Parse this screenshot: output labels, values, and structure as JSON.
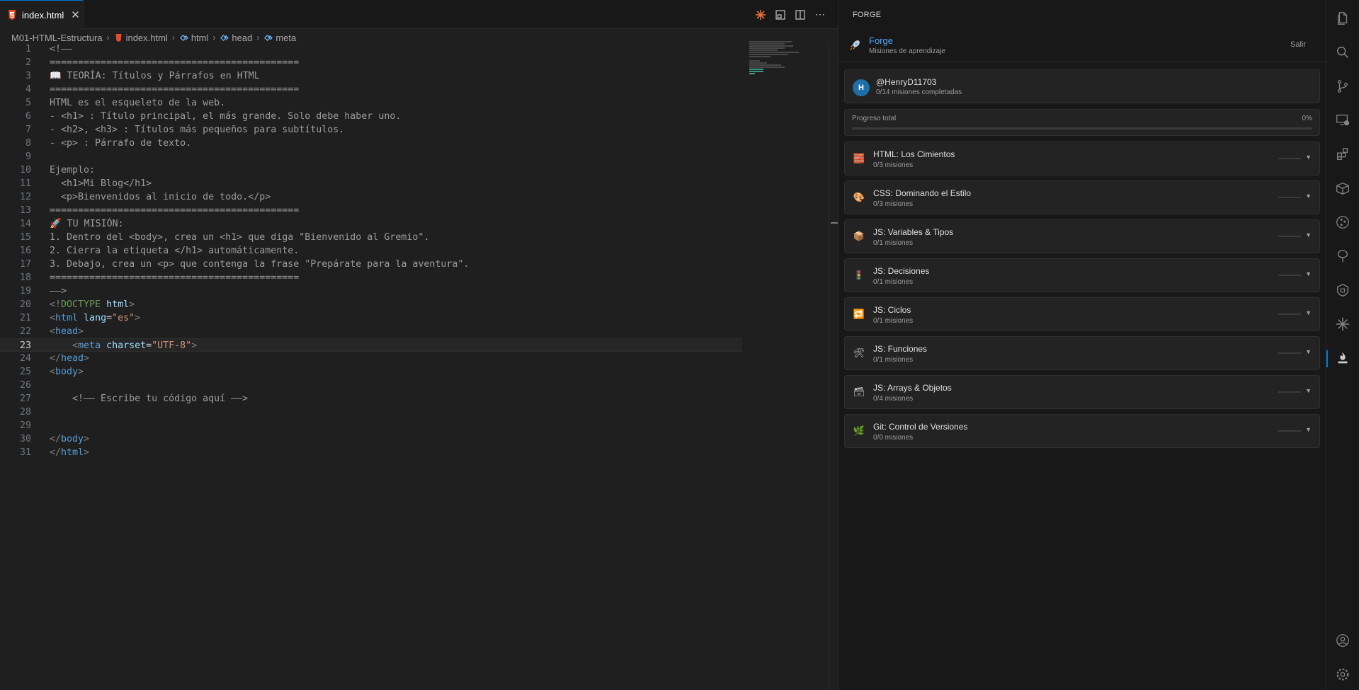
{
  "editor": {
    "tab_label": "index.html",
    "tab_close": "✕",
    "breadcrumb": {
      "folder": "M01-HTML-Estructura",
      "file": "index.html",
      "sym1": "html",
      "sym2": "head",
      "sym3": "meta"
    },
    "lines": [
      {
        "n": "1",
        "parts": [
          {
            "c": "cm",
            "t": "<!——"
          }
        ]
      },
      {
        "n": "2",
        "parts": [
          {
            "c": "cm",
            "t": "============================================"
          }
        ]
      },
      {
        "n": "3",
        "parts": [
          {
            "c": "cm",
            "t": "📖 TEORÍA: Títulos y Párrafos en HTML"
          }
        ]
      },
      {
        "n": "4",
        "parts": [
          {
            "c": "cm",
            "t": "============================================"
          }
        ]
      },
      {
        "n": "5",
        "parts": [
          {
            "c": "cm",
            "t": "HTML es el esqueleto de la web."
          }
        ]
      },
      {
        "n": "6",
        "parts": [
          {
            "c": "cm",
            "t": "- <h1> : Título principal, el más grande. Solo debe haber uno."
          }
        ]
      },
      {
        "n": "7",
        "parts": [
          {
            "c": "cm",
            "t": "- <h2>, <h3> : Títulos más pequeños para subtítulos."
          }
        ]
      },
      {
        "n": "8",
        "parts": [
          {
            "c": "cm",
            "t": "- <p> : Párrafo de texto."
          }
        ]
      },
      {
        "n": "9",
        "parts": [
          {
            "c": "cm",
            "t": ""
          }
        ]
      },
      {
        "n": "10",
        "parts": [
          {
            "c": "cm",
            "t": "Ejemplo:"
          }
        ]
      },
      {
        "n": "11",
        "parts": [
          {
            "c": "cm",
            "t": "  <h1>Mi Blog</h1>"
          }
        ]
      },
      {
        "n": "12",
        "parts": [
          {
            "c": "cm",
            "t": "  <p>Bienvenidos al inicio de todo.</p>"
          }
        ]
      },
      {
        "n": "13",
        "parts": [
          {
            "c": "cm",
            "t": "============================================"
          }
        ]
      },
      {
        "n": "14",
        "parts": [
          {
            "c": "cm",
            "t": "🚀 TU MISIÓN:"
          }
        ]
      },
      {
        "n": "15",
        "parts": [
          {
            "c": "cm",
            "t": "1. Dentro del <body>, crea un <h1> que diga \"Bienvenido al Gremio\"."
          }
        ]
      },
      {
        "n": "16",
        "parts": [
          {
            "c": "cm",
            "t": "2. Cierra la etiqueta </h1> automáticamente."
          }
        ]
      },
      {
        "n": "17",
        "parts": [
          {
            "c": "cm",
            "t": "3. Debajo, crea un <p> que contenga la frase \"Prepárate para la aventura\"."
          }
        ]
      },
      {
        "n": "18",
        "parts": [
          {
            "c": "cm",
            "t": "============================================"
          }
        ]
      },
      {
        "n": "19",
        "parts": [
          {
            "c": "cm",
            "t": "——>"
          }
        ]
      },
      {
        "n": "20",
        "parts": [
          {
            "c": "br",
            "t": "<!"
          },
          {
            "c": "dt",
            "t": "DOCTYPE"
          },
          {
            "c": "an",
            "t": " html"
          },
          {
            "c": "br",
            "t": ">"
          }
        ]
      },
      {
        "n": "21",
        "parts": [
          {
            "c": "br",
            "t": "<"
          },
          {
            "c": "tag",
            "t": "html"
          },
          {
            "c": "an",
            "t": " lang"
          },
          {
            "c": "txt0",
            "t": "="
          },
          {
            "c": "av",
            "t": "\"es\""
          },
          {
            "c": "br",
            "t": ">"
          }
        ]
      },
      {
        "n": "22",
        "parts": [
          {
            "c": "br",
            "t": "<"
          },
          {
            "c": "tag",
            "t": "head"
          },
          {
            "c": "br",
            "t": ">"
          }
        ]
      },
      {
        "n": "23",
        "parts": [
          {
            "c": "txt0",
            "t": "    "
          },
          {
            "c": "br",
            "t": "<"
          },
          {
            "c": "tag",
            "t": "meta"
          },
          {
            "c": "an",
            "t": " charset"
          },
          {
            "c": "txt0",
            "t": "="
          },
          {
            "c": "av",
            "t": "\"UTF-8\""
          },
          {
            "c": "br",
            "t": ">"
          }
        ]
      },
      {
        "n": "24",
        "parts": [
          {
            "c": "br",
            "t": "</"
          },
          {
            "c": "tag",
            "t": "head"
          },
          {
            "c": "br",
            "t": ">"
          }
        ]
      },
      {
        "n": "25",
        "parts": [
          {
            "c": "br",
            "t": "<"
          },
          {
            "c": "tag",
            "t": "body"
          },
          {
            "c": "br",
            "t": ">"
          }
        ]
      },
      {
        "n": "26",
        "parts": [
          {
            "c": "txt0",
            "t": ""
          }
        ]
      },
      {
        "n": "27",
        "parts": [
          {
            "c": "cm",
            "t": "    <!—— Escribe tu código aquí ——>"
          }
        ]
      },
      {
        "n": "28",
        "parts": [
          {
            "c": "txt0",
            "t": ""
          }
        ]
      },
      {
        "n": "29",
        "parts": [
          {
            "c": "txt0",
            "t": ""
          }
        ]
      },
      {
        "n": "30",
        "parts": [
          {
            "c": "br",
            "t": "</"
          },
          {
            "c": "tag",
            "t": "body"
          },
          {
            "c": "br",
            "t": ">"
          }
        ]
      },
      {
        "n": "31",
        "parts": [
          {
            "c": "br",
            "t": "</"
          },
          {
            "c": "tag",
            "t": "html"
          },
          {
            "c": "br",
            "t": ">"
          }
        ]
      }
    ],
    "active_line": "23"
  },
  "forge": {
    "panel_title": "FORGE",
    "title": "Forge",
    "subtitle": "Misiones de aprendizaje",
    "logout": "Salir",
    "user": {
      "avatar_letter": "H",
      "handle": "@HenryD11703",
      "completed": "0/14 misiones completadas"
    },
    "progress": {
      "label": "Progreso total",
      "pct_text": "0%",
      "value": 0
    },
    "modules": [
      {
        "icon": "🧱",
        "title": "HTML: Los Cimientos",
        "sub": "0/3 misiones"
      },
      {
        "icon": "🎨",
        "title": "CSS: Dominando el Estilo",
        "sub": "0/3 misiones"
      },
      {
        "icon": "📦",
        "title": "JS: Variables & Tipos",
        "sub": "0/1 misiones"
      },
      {
        "icon": "🚦",
        "title": "JS: Decisiones",
        "sub": "0/1 misiones"
      },
      {
        "icon": "🔁",
        "title": "JS: Ciclos",
        "sub": "0/1 misiones"
      },
      {
        "icon": "🛠",
        "title": "JS: Funciones",
        "sub": "0/1 misiones"
      },
      {
        "icon": "🗃",
        "title": "JS: Arrays & Objetos",
        "sub": "0/4 misiones"
      },
      {
        "icon": "🌿",
        "title": "Git: Control de Versiones",
        "sub": "0/0 misiones"
      }
    ]
  },
  "colors": {
    "accent": "#0078d4",
    "link": "#4daafc",
    "avatar": "#1e6ea7",
    "html_icon": "#e44d26"
  },
  "activity_icons": [
    "explorer-icon",
    "search-icon",
    "source-control-icon",
    "remote-explorer-icon",
    "extensions-icon",
    "containers-icon",
    "git-graph-icon",
    "tree-icon",
    "security-icon",
    "starburst-icon",
    "forge-icon",
    "account-icon",
    "settings-icon"
  ]
}
